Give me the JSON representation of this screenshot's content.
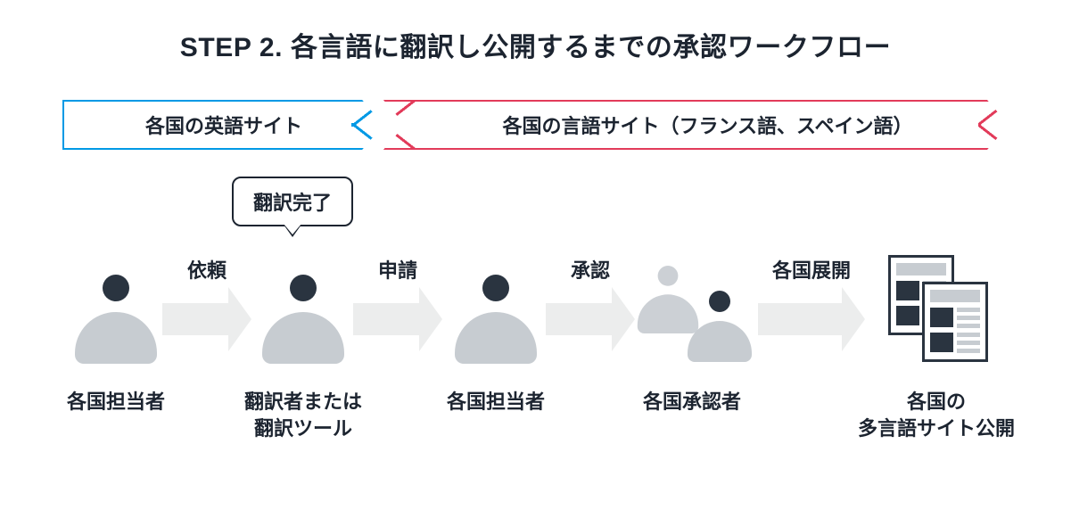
{
  "title": "STEP 2. 各言語に翻訳し公開するまでの承認ワークフロー",
  "bar": {
    "left": "各国の英語サイト",
    "right": "各国の言語サイト（フランス語、スペイン語）"
  },
  "bubble": "翻訳完了",
  "arrows": {
    "a1": "依頼",
    "a2": "申請",
    "a3": "承認",
    "a4": "各国展開"
  },
  "roles": {
    "r1": "各国担当者",
    "r2": "翻訳者または\n翻訳ツール",
    "r3": "各国担当者",
    "r4": "各国承認者",
    "r5": "各国の\n多言語サイト公開"
  },
  "colors": {
    "blue": "#0099e5",
    "red": "#e23b5a",
    "dark": "#2a3440",
    "grey": "#c7ccd1",
    "arrow": "#eceded"
  }
}
